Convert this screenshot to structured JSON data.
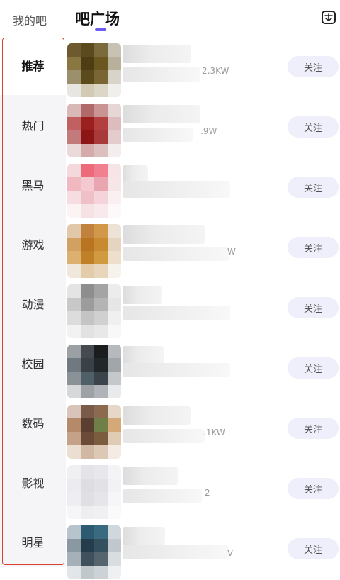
{
  "header": {
    "tab_my": "我的吧",
    "tab_square": "吧广场",
    "signin_icon": "sign-in-calendar-icon"
  },
  "sidebar": {
    "items": [
      {
        "label": "推荐",
        "active": true
      },
      {
        "label": "热门"
      },
      {
        "label": "黑马"
      },
      {
        "label": "游戏"
      },
      {
        "label": "动漫"
      },
      {
        "label": "校园"
      },
      {
        "label": "数码"
      },
      {
        "label": "影视"
      },
      {
        "label": "明星"
      }
    ]
  },
  "list": {
    "follow_label": "关注",
    "rows": [
      {
        "stat": "2.3KW"
      },
      {
        "stat": ".9W"
      },
      {
        "stat": ""
      },
      {
        "stat": "W"
      },
      {
        "stat": ""
      },
      {
        "stat": ""
      },
      {
        "stat": ".1KW"
      },
      {
        "stat": "2"
      },
      {
        "stat": "V"
      }
    ]
  },
  "colors": {
    "accent": "#6d5cf0",
    "highlight_frame": "#d9402f",
    "follow_bg": "#efeffb"
  }
}
